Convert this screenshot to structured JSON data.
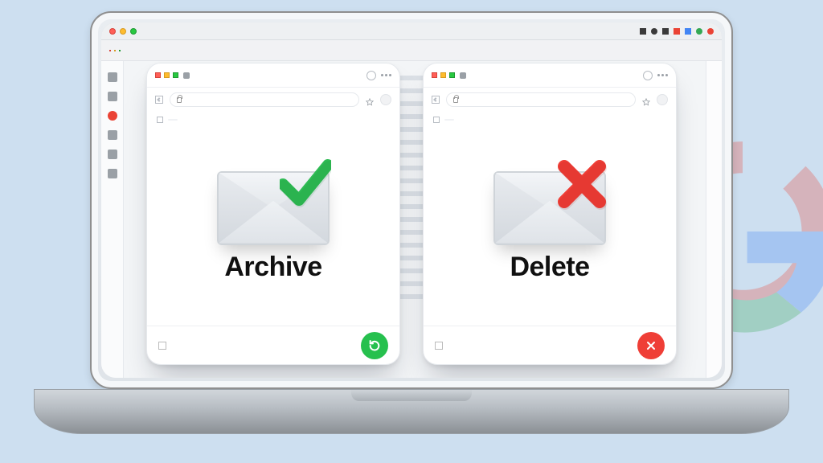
{
  "menubar": {
    "title": ""
  },
  "cards": {
    "archive": {
      "title": "Archive",
      "accent": "#2fbb54",
      "tab_text": "",
      "url_text": "",
      "footer_text": "",
      "fab_icon": "refresh-icon"
    },
    "delete": {
      "title": "Delete",
      "accent": "#ef3e36",
      "tab_text": "",
      "url_text": "",
      "footer_text": "",
      "fab_icon": "close-icon"
    }
  }
}
